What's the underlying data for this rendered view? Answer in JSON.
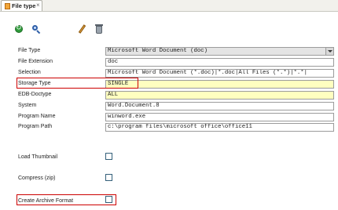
{
  "tab": {
    "label": "File type",
    "close": "×"
  },
  "toolbar": {
    "refresh_icon": "refresh-icon",
    "search_icon": "search-icon",
    "edit_icon": "pencil-icon",
    "delete_icon": "trash-icon"
  },
  "fields": {
    "file_type": {
      "label": "File Type",
      "value": "Microsoft Word Document (doc)"
    },
    "file_extension": {
      "label": "File Extension",
      "value": "doc"
    },
    "selection": {
      "label": "Selection",
      "value": "Microsoft Word Document (*.doc)|*.doc|All Files (*.*)|*.*|"
    },
    "storage_type": {
      "label": "Storage Type",
      "value": "SINGLE"
    },
    "edb_doctype": {
      "label": "EDB-Doctype",
      "value": "ALL"
    },
    "system": {
      "label": "System",
      "value": "Word.Document.8"
    },
    "program_name": {
      "label": "Program Name",
      "value": "winword.exe"
    },
    "program_path": {
      "label": "Program Path",
      "value": "c:\\program files\\microsoft office\\office11"
    }
  },
  "checkboxes": {
    "load_thumbnail": {
      "label": "Load Thumbnail",
      "checked": false
    },
    "compress": {
      "label": "Compress (zip)",
      "checked": false
    },
    "archive_format": {
      "label": "Create Archive Format",
      "checked": false
    }
  },
  "colors": {
    "highlight": "#cc0000",
    "required_field": "#ffffc0",
    "readonly_field": "#e4e4e4"
  }
}
